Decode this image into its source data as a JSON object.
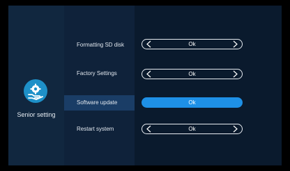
{
  "sidebar": {
    "title": "Senior setting",
    "icon": "settings-hand-icon",
    "accent": "#1e90c8"
  },
  "settings": {
    "rows": [
      {
        "label": "Formatting SD disk",
        "value": "Ok"
      },
      {
        "label": "Factory Settings",
        "value": "Ok"
      },
      {
        "label": "Software update",
        "value": "Ok",
        "selected": true
      },
      {
        "label": "Restart system",
        "value": "Ok"
      }
    ]
  },
  "colors": {
    "highlight": "#1a3d66",
    "active_button": "#1e90e6"
  }
}
